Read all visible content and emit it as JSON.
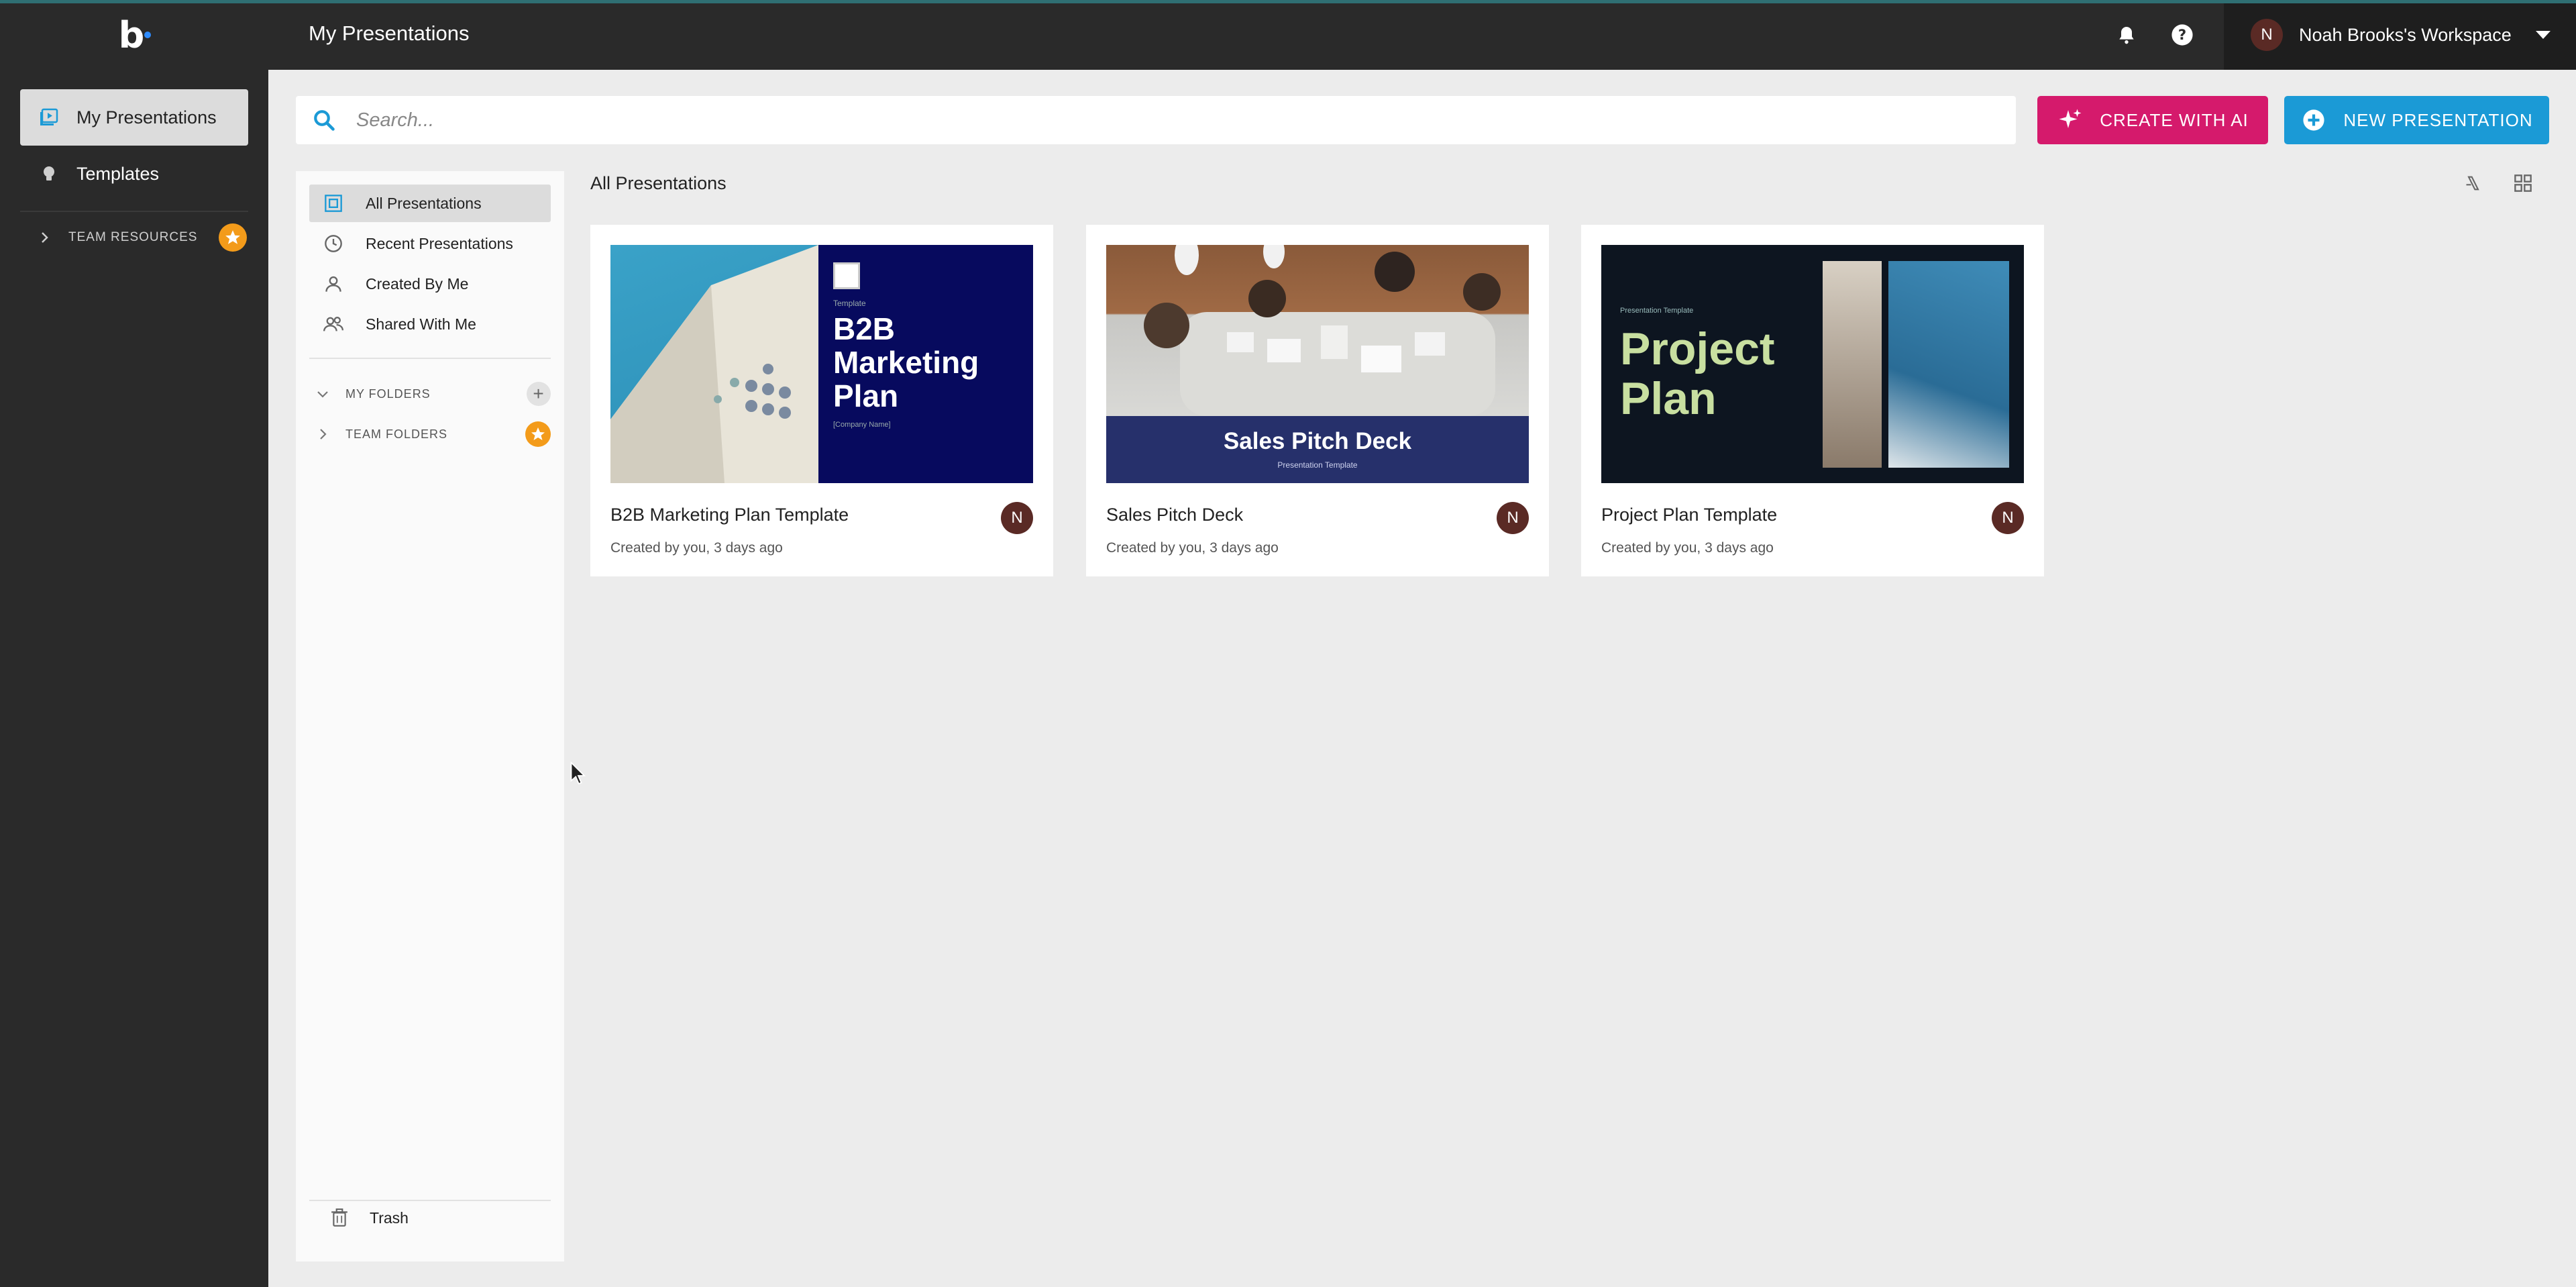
{
  "app": {
    "logo_text": "b",
    "page_title": "My Presentations"
  },
  "nav": {
    "items": [
      {
        "label": "My Presentations",
        "icon": "presentation-icon",
        "active": true
      },
      {
        "label": "Templates",
        "icon": "lightbulb-icon",
        "active": false
      }
    ],
    "team_resources_label": "TEAM RESOURCES"
  },
  "topbar": {
    "workspace_name": "Noah Brooks's Workspace",
    "avatar_initial": "N"
  },
  "search": {
    "placeholder": "Search..."
  },
  "actions": {
    "create_ai_label": "CREATE WITH AI",
    "new_presentation_label": "NEW PRESENTATION"
  },
  "filters": {
    "items": [
      {
        "label": "All Presentations",
        "icon": "all-presentations-icon"
      },
      {
        "label": "Recent Presentations",
        "icon": "clock-icon"
      },
      {
        "label": "Created By Me",
        "icon": "user-icon"
      },
      {
        "label": "Shared With Me",
        "icon": "users-icon"
      }
    ],
    "my_folders_label": "MY FOLDERS",
    "team_folders_label": "TEAM FOLDERS",
    "trash_label": "Trash"
  },
  "main": {
    "section_title": "All Presentations",
    "cards": [
      {
        "name": "B2B Marketing Plan Template",
        "meta": "Created by you, 3 days ago",
        "avatar": "N",
        "thumb_small": "Template",
        "thumb_title": "B2B Marketing Plan",
        "thumb_sub": "[Company Name]"
      },
      {
        "name": "Sales Pitch Deck",
        "meta": "Created by you, 3 days ago",
        "avatar": "N",
        "thumb_title": "Sales Pitch Deck",
        "thumb_sub": "Presentation Template"
      },
      {
        "name": "Project Plan Template",
        "meta": "Created by you, 3 days ago",
        "avatar": "N",
        "thumb_small": "Presentation Template",
        "thumb_title": "Project Plan"
      }
    ]
  },
  "colors": {
    "nav_bg": "#2a2a2a",
    "ai_button": "#d51a6c",
    "new_button": "#1b9ad6",
    "star_badge": "#f39b1a",
    "avatar_bg": "#5a2a25"
  }
}
